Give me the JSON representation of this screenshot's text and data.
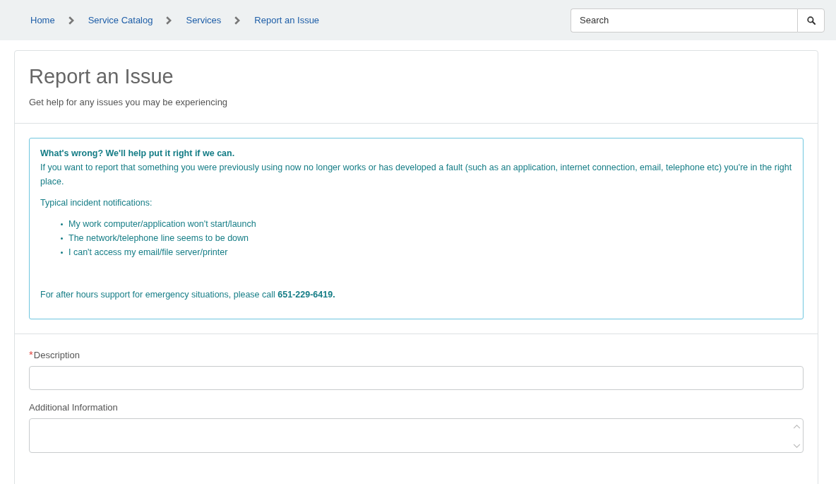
{
  "breadcrumb": [
    {
      "label": "Home"
    },
    {
      "label": "Service Catalog"
    },
    {
      "label": "Services"
    },
    {
      "label": "Report an Issue"
    }
  ],
  "search": {
    "placeholder": "Search"
  },
  "header": {
    "title": "Report an Issue",
    "subtitle": "Get help for any issues you may be experiencing"
  },
  "notice": {
    "heading": "What's wrong? We'll help put it right if we can.",
    "intro": "If you want to report that something you were previously using now no longer works or has developed a fault (such as an application, internet connection, email, telephone etc) you're in the right place.",
    "list_title": "Typical incident notifications:",
    "items": [
      "My work computer/application won't start/launch",
      "The network/telephone line seems to be down",
      "I can't access my email/file server/printer"
    ],
    "footer": "For after hours support for emergency situations, please call **651-229-6419.**"
  },
  "fields": [
    {
      "kind": "input",
      "label": "Description",
      "required_mark": "*"
    },
    {
      "kind": "textarea",
      "label": "Additional Information"
    }
  ]
}
